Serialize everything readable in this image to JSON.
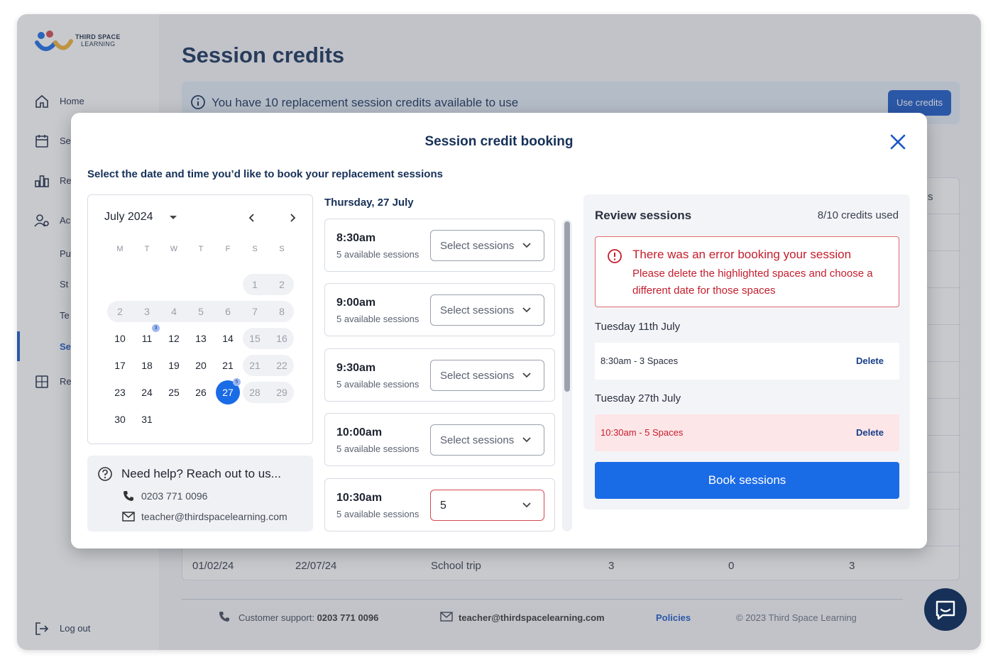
{
  "brand": {
    "line1": "THIRD SPACE",
    "line2": "LEARNING",
    "colors": {
      "navy": "#163058",
      "accent": "#1a6be6",
      "error": "#c41d2c"
    }
  },
  "sidebar": {
    "items": [
      {
        "label": "Home",
        "icon": "home-icon"
      },
      {
        "label": "Se",
        "icon": "calendar-icon"
      },
      {
        "label": "Re",
        "icon": "chart-icon"
      },
      {
        "label": "Ac",
        "icon": "users-icon"
      },
      {
        "label": "Re",
        "icon": "calculator-icon"
      }
    ],
    "subitems": [
      "Pu",
      "St",
      "Te",
      "Se"
    ],
    "logout": "Log out"
  },
  "page": {
    "title": "Session credits",
    "banner": {
      "text": "You have 10 replacement session credits available to use",
      "button": "Use credits"
    },
    "table_header_fragment": "s",
    "last_row": [
      "01/02/24",
      "22/07/24",
      "School trip",
      "3",
      "0",
      "3"
    ]
  },
  "footer": {
    "support_label": "Customer support:",
    "support_phone": "0203 771 0096",
    "email": "teacher@thirdspacelearning.com",
    "policies": "Policies",
    "copyright": "© 2023 Third Space Learning"
  },
  "modal": {
    "title": "Session credit booking",
    "instructions": "Select the date and time you’d like to book your replacement sessions",
    "calendar": {
      "month": "July 2024",
      "weekdays": [
        "M",
        "T",
        "W",
        "T",
        "F",
        "S",
        "S"
      ],
      "weeks": [
        [
          "",
          "",
          "",
          "",
          "",
          "1",
          "2"
        ],
        [
          "2",
          "3",
          "4",
          "5",
          "6",
          "7",
          "8"
        ],
        [
          "10",
          "11",
          "12",
          "13",
          "14",
          "15",
          "16"
        ],
        [
          "17",
          "18",
          "19",
          "20",
          "21",
          "21",
          "22"
        ],
        [
          "23",
          "24",
          "25",
          "26",
          "27",
          "28",
          "29"
        ],
        [
          "30",
          "31",
          "",
          "",
          "",
          "",
          ""
        ]
      ],
      "selected": "27",
      "badges": {
        "11": "3",
        "27": "5"
      }
    },
    "help": {
      "title": "Need help? Reach out to us...",
      "phone": "0203 771 0096",
      "email": "teacher@thirdspacelearning.com"
    },
    "day_heading": "Thursday, 27 July",
    "slots": [
      {
        "time": "8:30am",
        "available": "5 available sessions",
        "select": "Select sessions"
      },
      {
        "time": "9:00am",
        "available": "5 available sessions",
        "select": "Select sessions"
      },
      {
        "time": "9:30am",
        "available": "5 available sessions",
        "select": "Select sessions"
      },
      {
        "time": "10:00am",
        "available": "5 available sessions",
        "select": "Select sessions"
      },
      {
        "time": "10:30am",
        "available": "5 available sessions",
        "select": "5"
      }
    ],
    "review": {
      "title": "Review sessions",
      "credits": "8/10 credits used",
      "error_title": "There was an error booking your session",
      "error_message": "Please delete the highlighted spaces and choose a different date for those spaces",
      "groups": [
        {
          "date": "Tuesday 11th July",
          "item": "8:30am - 3 Spaces",
          "delete": "Delete"
        },
        {
          "date": "Tuesday 27th July",
          "item": "10:30am - 5 Spaces",
          "delete": "Delete"
        }
      ],
      "book": "Book sessions"
    }
  }
}
